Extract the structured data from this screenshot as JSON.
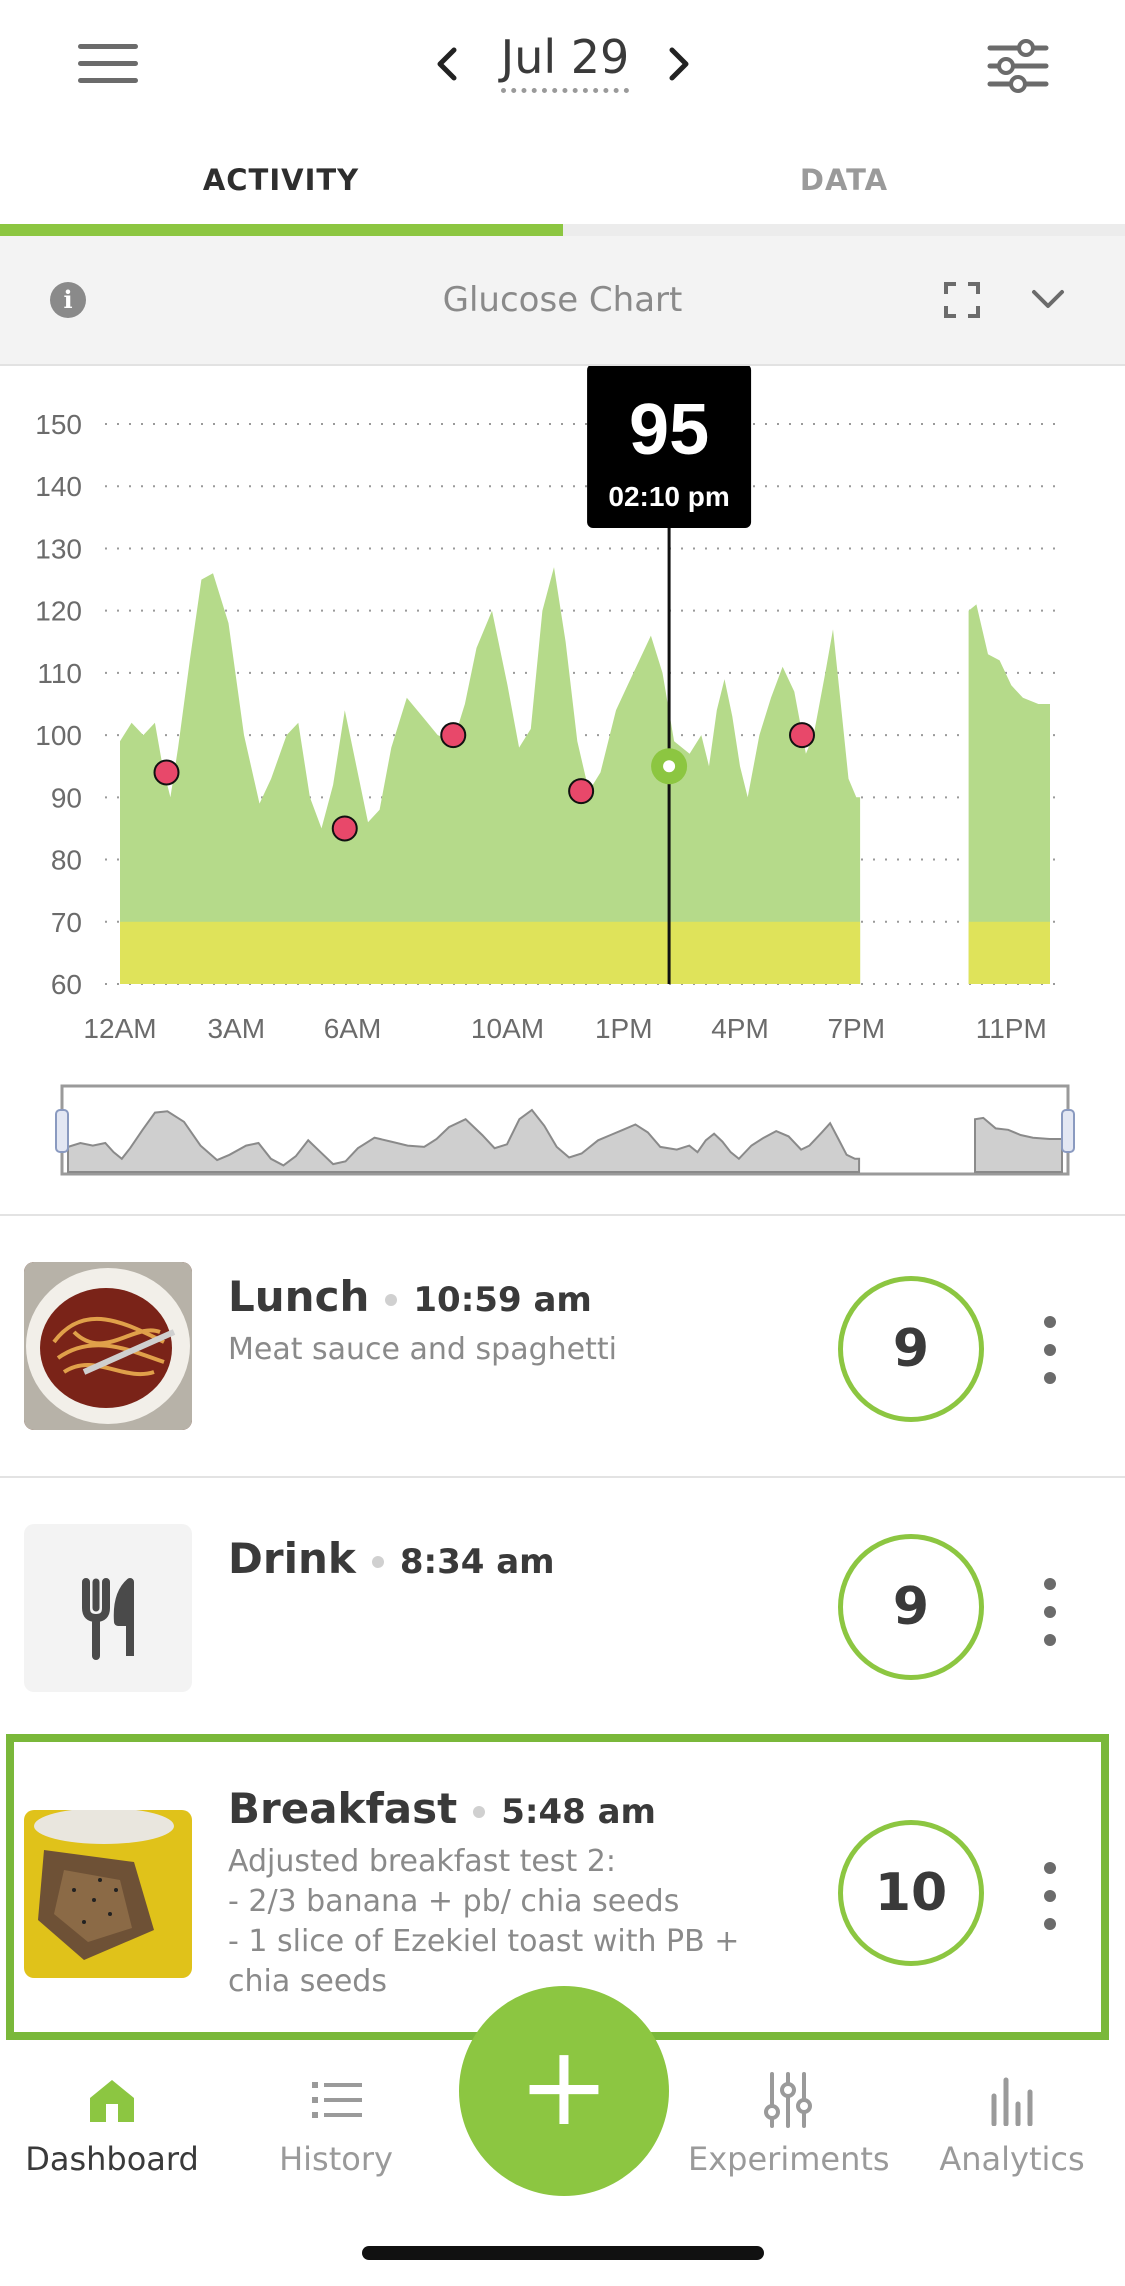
{
  "header": {
    "date": "Jul 29",
    "tabs": [
      {
        "label": "ACTIVITY",
        "active": true
      },
      {
        "label": "DATA",
        "active": false
      }
    ]
  },
  "glucose_panel": {
    "title": "Glucose Chart",
    "info_icon": "info-icon",
    "expand_icon": "fullscreen-icon",
    "collapse_icon": "chevron-down-icon"
  },
  "chart_data": {
    "type": "area",
    "y_ticks": [
      "150",
      "140",
      "130",
      "120",
      "110",
      "100",
      "90",
      "80",
      "70",
      "60"
    ],
    "x_ticks": [
      "12AM",
      "3AM",
      "6AM",
      "10AM",
      "1PM",
      "4PM",
      "7PM",
      "11PM"
    ],
    "ylim": [
      60,
      150
    ],
    "tooltip": {
      "value": "95",
      "time": "02:10 pm"
    },
    "colors": {
      "area": "#b5da8a",
      "low_band": "#dfe35a",
      "marker": "#e8486a",
      "accent": "#8cc641"
    }
  },
  "entries": [
    {
      "name": "Lunch",
      "time": "10:59 am",
      "description": "Meat sauce and spaghetti",
      "score": "9",
      "thumb": "spaghetti-photo"
    },
    {
      "name": "Drink",
      "time": "8:34 am",
      "description": "",
      "score": "9",
      "thumb": "fork-knife-icon"
    },
    {
      "name": "Breakfast",
      "time": "5:48 am",
      "description": "Adjusted breakfast test 2:\n- 2/3 banana + pb/ chia seeds\n- 1 slice of Ezekiel toast with PB + chia seeds",
      "score": "10",
      "thumb": "toast-photo"
    }
  ],
  "nav": {
    "items": [
      {
        "label": "Dashboard",
        "icon": "home-icon",
        "active": true
      },
      {
        "label": "History",
        "icon": "list-icon",
        "active": false
      },
      {
        "label": "Experiments",
        "icon": "sliders-icon",
        "active": false
      },
      {
        "label": "Analytics",
        "icon": "bar-chart-icon",
        "active": false
      }
    ],
    "add_label": "+"
  }
}
